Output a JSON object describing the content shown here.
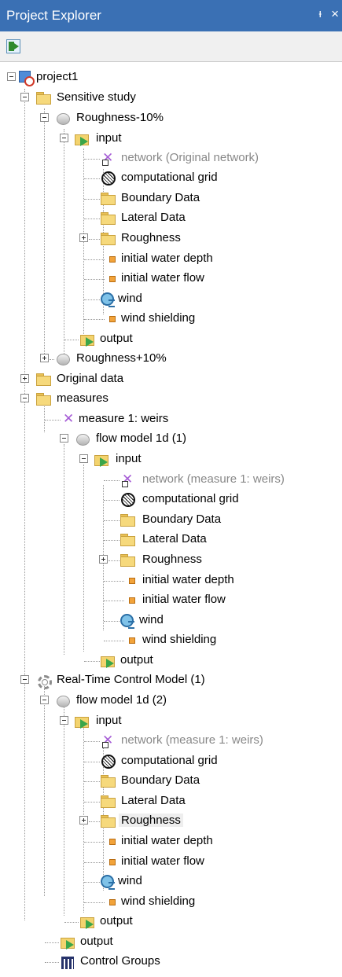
{
  "panel": {
    "title": "Project Explorer",
    "pin_glyph": "ᵼ",
    "close_glyph": "×"
  },
  "toolbar": {
    "sync_icon": "sync-with-editor-icon"
  },
  "tree": {
    "project": "project1",
    "sensitive_study": "Sensitive study",
    "roughness_minus": "Roughness-10%",
    "input": "input",
    "network_original": "network (Original network)",
    "computational_grid": "computational grid",
    "boundary_data": "Boundary Data",
    "lateral_data": "Lateral Data",
    "roughness": "Roughness",
    "initial_water_depth": "initial water depth",
    "initial_water_flow": "initial water flow",
    "wind": "wind",
    "wind_shielding": "wind shielding",
    "output": "output",
    "roughness_plus": "Roughness+10%",
    "original_data": "Original data",
    "measures": "measures",
    "measure_1": "measure 1: weirs",
    "flow_model_1": "flow model 1d (1)",
    "network_measure": "network (measure 1: weirs)",
    "rtc_model": "Real-Time Control Model (1)",
    "flow_model_2": "flow model 1d (2)",
    "control_groups": "Control Groups"
  }
}
